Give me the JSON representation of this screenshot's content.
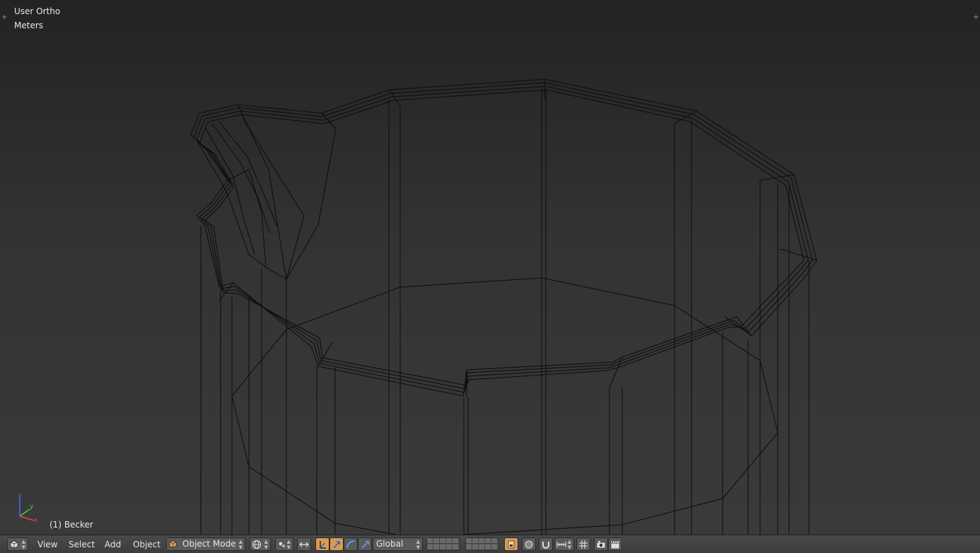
{
  "viewport": {
    "view_name": "User Ortho",
    "units": "Meters",
    "object_label": "(1) Becker",
    "axes": {
      "x": "x",
      "y": "y",
      "z": "z"
    },
    "corner_widget": "+"
  },
  "header": {
    "editor_type_icon": "3d-view-cube-icon",
    "menus": {
      "view": "View",
      "select": "Select",
      "add": "Add",
      "object": "Object"
    },
    "mode": "Object Mode",
    "transform_orientation": "Global",
    "colors": {
      "active_button": "#d89a52",
      "bar": "#434343",
      "widget": "#5a5a5a"
    }
  }
}
